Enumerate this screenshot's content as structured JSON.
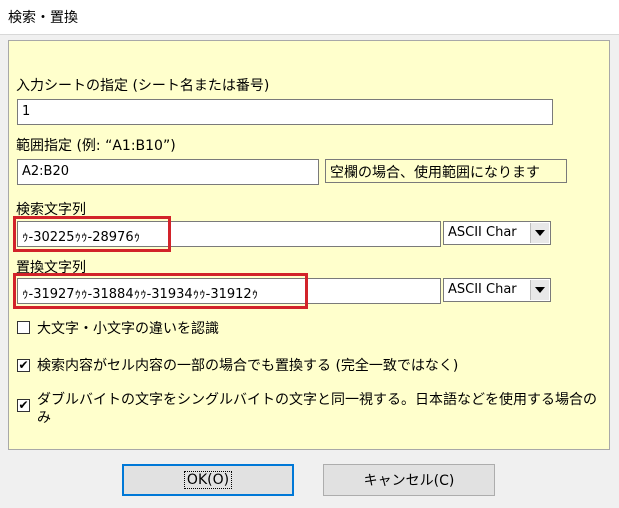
{
  "window": {
    "title": "検索・置換"
  },
  "sheet": {
    "label": "入力シートの指定 (シート名または番号)",
    "value": "1"
  },
  "range": {
    "label": "範囲指定 (例: “A1:B10”)",
    "value": "A2:B20",
    "note": "空欄の場合、使用範囲になります"
  },
  "search": {
    "label": "検索文字列",
    "value": "ｩ-30225ｩｩ-28976ｩ",
    "encoding": "ASCII Char"
  },
  "replace": {
    "label": "置換文字列",
    "value": "ｩ-31927ｩｩ-31884ｩｩ-31934ｩｩ-31912ｩ",
    "encoding": "ASCII Char"
  },
  "options": [
    {
      "label": "大文字・小文字の違いを認識",
      "checked": false
    },
    {
      "label": "検索内容がセル内容の一部の場合でも置換する (完全一致ではなく)",
      "checked": true
    },
    {
      "label": "ダブルバイトの文字をシングルバイトの文字と同一視する。日本語などを使用する場合のみ",
      "checked": true
    }
  ],
  "buttons": {
    "ok": "OK(O)",
    "cancel": "キャンセル(C)"
  },
  "check_mark": "✔",
  "colors": {
    "panel": "#ffffcc",
    "highlight": "#d2232a",
    "default_button_border": "#0078d7"
  }
}
